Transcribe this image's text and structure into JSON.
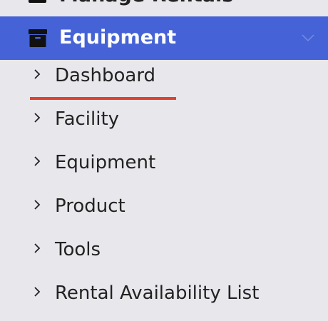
{
  "menu": {
    "previous_item": {
      "label": "Manage Rentals",
      "icon": "archive-icon"
    },
    "section": {
      "title": "Equipment",
      "icon": "archive-box-icon",
      "expanded": true,
      "accent_color": "#4563d6"
    },
    "items": [
      {
        "label": "Dashboard",
        "active": true
      },
      {
        "label": "Facility"
      },
      {
        "label": "Equipment"
      },
      {
        "label": "Product"
      },
      {
        "label": "Tools"
      },
      {
        "label": "Rental Availability List"
      }
    ],
    "active_underline_color": "#e0422f"
  }
}
